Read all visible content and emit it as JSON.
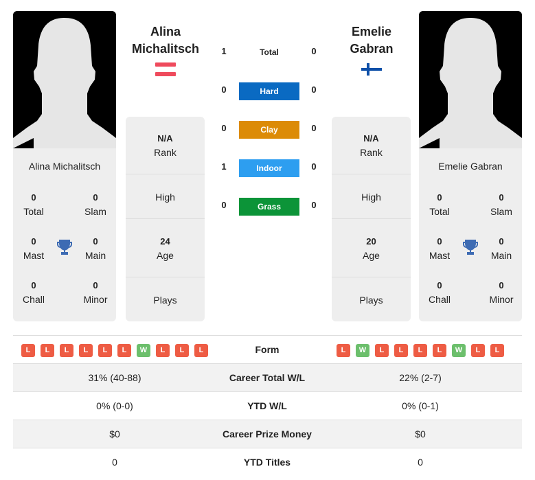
{
  "players": [
    {
      "name": "Alina Michalitsch",
      "name_line1": "Alina",
      "name_line2": "Michalitsch",
      "flag": "austria-flag",
      "stats": {
        "total": {
          "value": "0",
          "label": "Total"
        },
        "slam": {
          "value": "0",
          "label": "Slam"
        },
        "mast": {
          "value": "0",
          "label": "Mast"
        },
        "main": {
          "value": "0",
          "label": "Main"
        },
        "chall": {
          "value": "0",
          "label": "Chall"
        },
        "minor": {
          "value": "0",
          "label": "Minor"
        }
      },
      "info": {
        "rank_value": "N/A",
        "rank_label": "Rank",
        "high_label": "High",
        "age_value": "24",
        "age_label": "Age",
        "plays_label": "Plays"
      },
      "form": [
        "L",
        "L",
        "L",
        "L",
        "L",
        "L",
        "W",
        "L",
        "L",
        "L"
      ],
      "career_total_wl": "31% (40-88)",
      "ytd_wl": "0% (0-0)",
      "career_prize_money": "$0",
      "ytd_titles": "0"
    },
    {
      "name": "Emelie Gabran",
      "name_line1": "Emelie",
      "name_line2": "Gabran",
      "flag": "finland-flag",
      "stats": {
        "total": {
          "value": "0",
          "label": "Total"
        },
        "slam": {
          "value": "0",
          "label": "Slam"
        },
        "mast": {
          "value": "0",
          "label": "Mast"
        },
        "main": {
          "value": "0",
          "label": "Main"
        },
        "chall": {
          "value": "0",
          "label": "Chall"
        },
        "minor": {
          "value": "0",
          "label": "Minor"
        }
      },
      "info": {
        "rank_value": "N/A",
        "rank_label": "Rank",
        "high_label": "High",
        "age_value": "20",
        "age_label": "Age",
        "plays_label": "Plays"
      },
      "form": [
        "L",
        "W",
        "L",
        "L",
        "L",
        "L",
        "W",
        "L",
        "L"
      ],
      "career_total_wl": "22% (2-7)",
      "ytd_wl": "0% (0-1)",
      "career_prize_money": "$0",
      "ytd_titles": "0"
    }
  ],
  "h2h": [
    {
      "label": "Total",
      "left": "1",
      "right": "0",
      "color": null
    },
    {
      "label": "Hard",
      "left": "0",
      "right": "0",
      "color": "#0a6ac2"
    },
    {
      "label": "Clay",
      "left": "0",
      "right": "0",
      "color": "#dc8b07"
    },
    {
      "label": "Indoor",
      "left": "1",
      "right": "0",
      "color": "#2d9ef0"
    },
    {
      "label": "Grass",
      "left": "0",
      "right": "0",
      "color": "#0c9438"
    }
  ],
  "comparison_labels": {
    "form": "Form",
    "career_total_wl": "Career Total W/L",
    "ytd_wl": "YTD W/L",
    "career_prize_money": "Career Prize Money",
    "ytd_titles": "YTD Titles"
  },
  "colors": {
    "loss": "#ee5c44",
    "win": "#6cbf6c",
    "trophy": "#3d6bb3"
  }
}
